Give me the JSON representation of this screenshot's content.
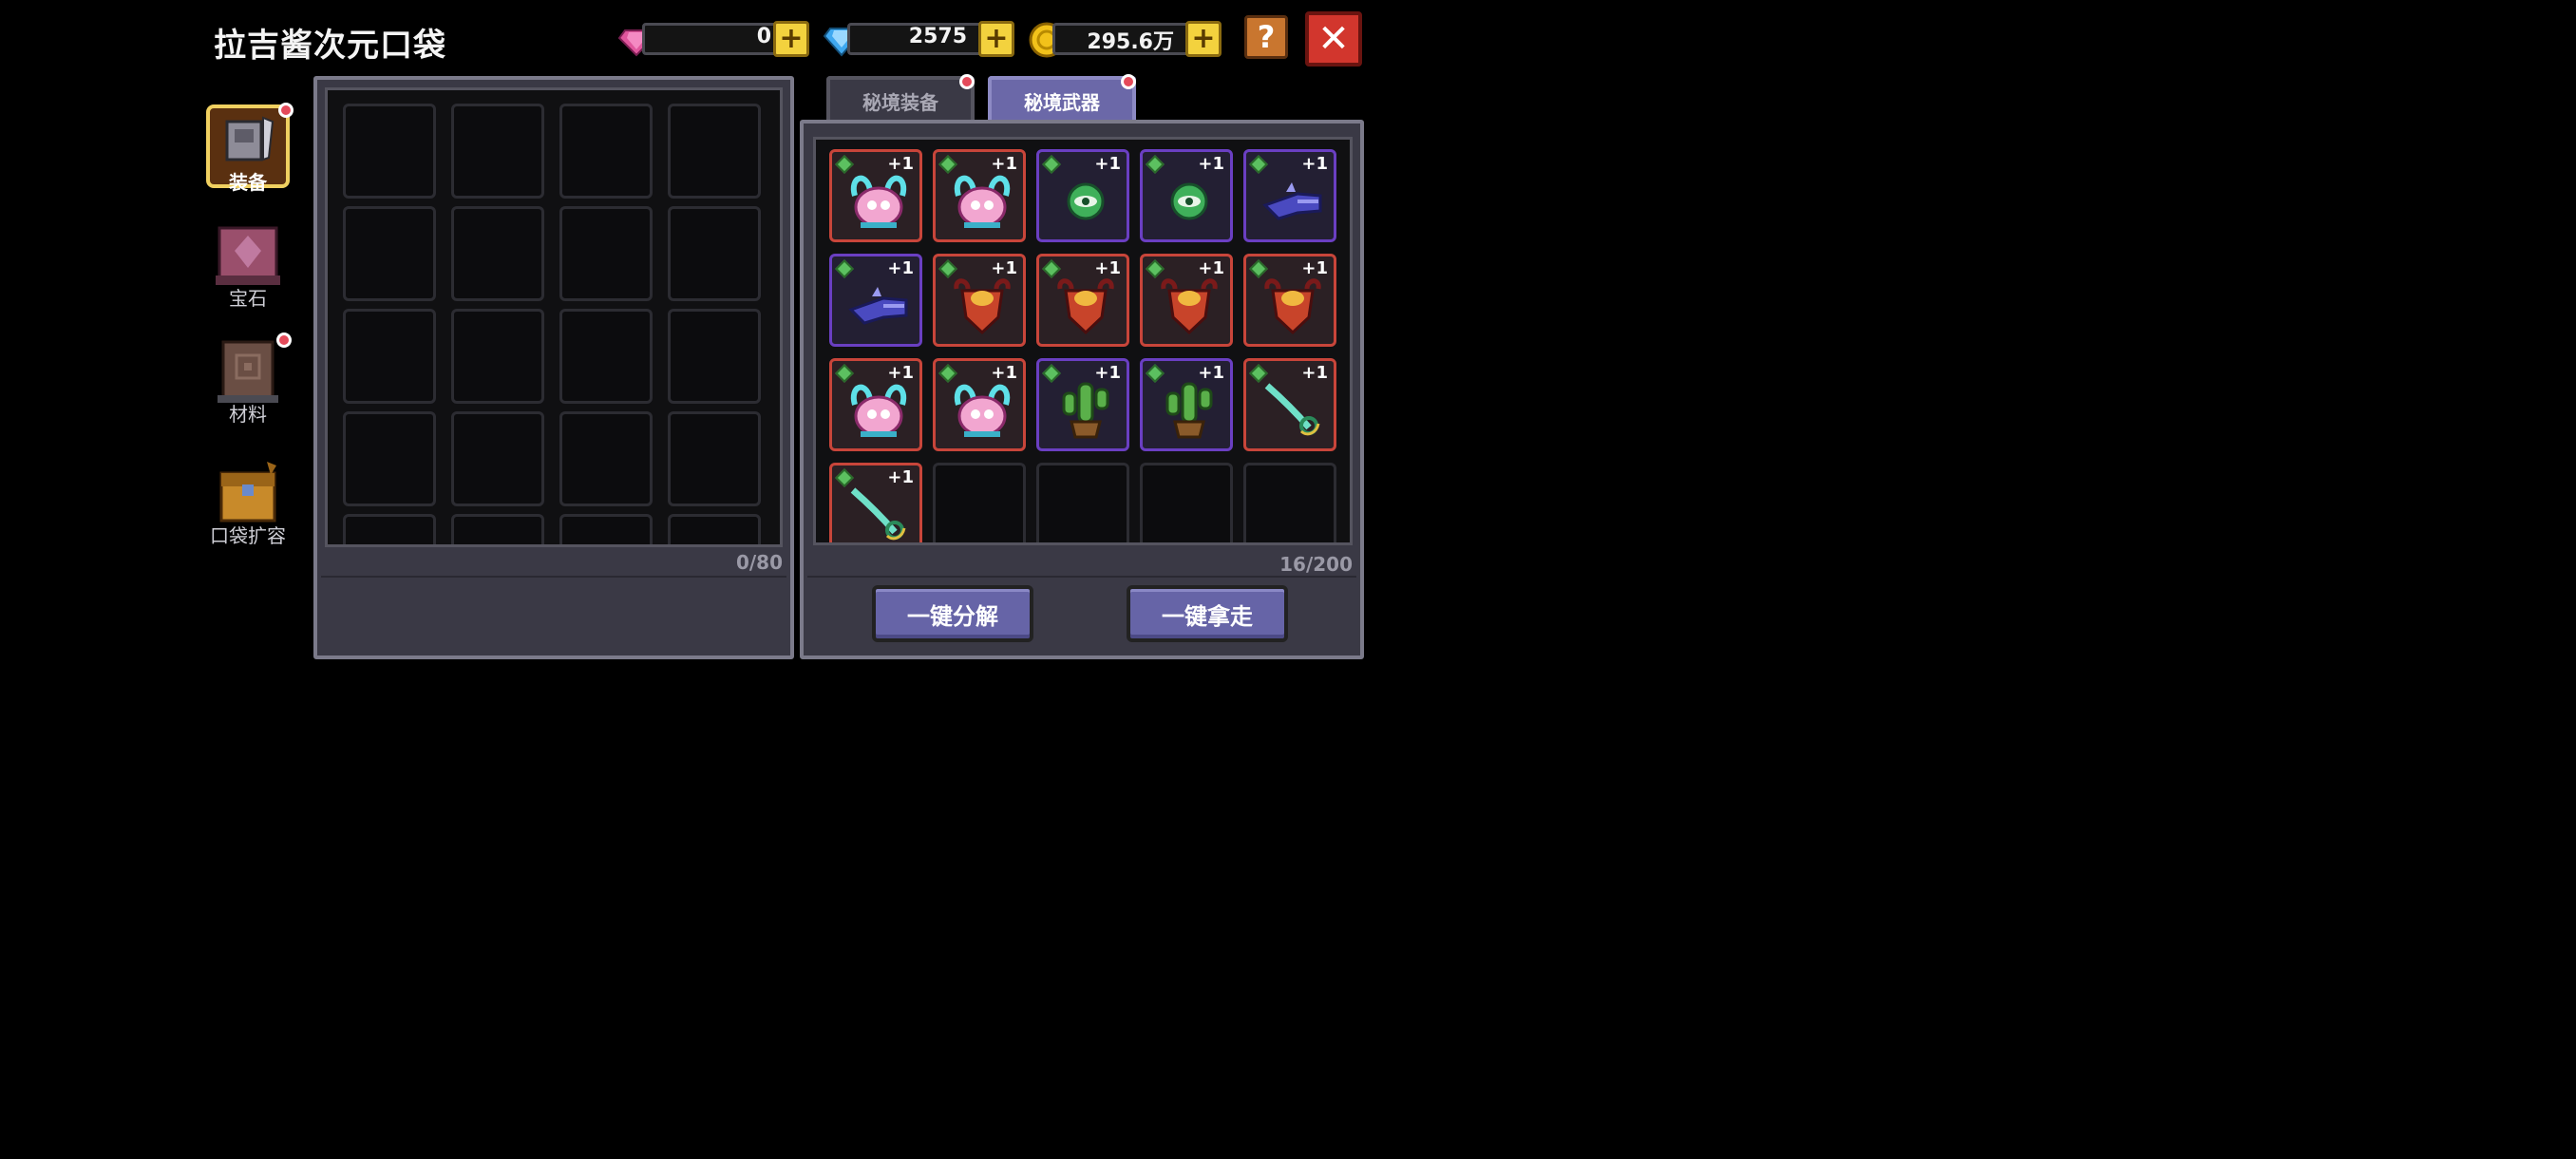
{
  "header": {
    "title": "拉吉酱次元口袋"
  },
  "currency": {
    "pink_gem": "0",
    "diamond": "2575",
    "gold": "295.6万",
    "plus_label": "+"
  },
  "help_label": "?",
  "close_label": "✕",
  "nav": [
    {
      "label": "装备",
      "icon": "armor-icon",
      "active": true,
      "badge": true
    },
    {
      "label": "宝石",
      "icon": "gem-throne-icon",
      "active": false,
      "badge": false
    },
    {
      "label": "材料",
      "icon": "material-box-icon",
      "active": false,
      "badge": true
    },
    {
      "label": "口袋扩容",
      "icon": "treasure-chest-icon",
      "active": false,
      "badge": false
    }
  ],
  "left_panel": {
    "counter": "0/80"
  },
  "tabs": [
    {
      "label": "秘境装备",
      "active": false
    },
    {
      "label": "秘境武器",
      "active": true
    }
  ],
  "right_panel": {
    "counter": "16/200",
    "items": [
      {
        "name": "bunny-mask",
        "rarity": "red",
        "level": "+1"
      },
      {
        "name": "bunny-mask",
        "rarity": "red",
        "level": "+1"
      },
      {
        "name": "green-eye-orb",
        "rarity": "purple",
        "level": "+1"
      },
      {
        "name": "green-eye-orb",
        "rarity": "purple",
        "level": "+1"
      },
      {
        "name": "blue-blaster",
        "rarity": "purple",
        "level": "+1"
      },
      {
        "name": "blue-blaster",
        "rarity": "purple",
        "level": "+1"
      },
      {
        "name": "horned-shield",
        "rarity": "red",
        "level": "+1"
      },
      {
        "name": "horned-shield",
        "rarity": "red",
        "level": "+1"
      },
      {
        "name": "horned-shield",
        "rarity": "red",
        "level": "+1"
      },
      {
        "name": "horned-shield",
        "rarity": "red",
        "level": "+1"
      },
      {
        "name": "bunny-mask",
        "rarity": "red",
        "level": "+1"
      },
      {
        "name": "bunny-mask",
        "rarity": "red",
        "level": "+1"
      },
      {
        "name": "potted-cactus",
        "rarity": "purple",
        "level": "+1"
      },
      {
        "name": "potted-cactus",
        "rarity": "purple",
        "level": "+1"
      },
      {
        "name": "jade-dagger",
        "rarity": "red",
        "level": "+1"
      },
      {
        "name": "jade-dagger",
        "rarity": "red",
        "level": "+1"
      }
    ]
  },
  "buttons": {
    "dismantle": "一键分解",
    "take_all": "一键拿走"
  },
  "colors": {
    "red_rarity": "#c8453a",
    "purple_rarity": "#6a3fc2",
    "tab_active": "#6b68a8",
    "plus_button": "#f3d23e",
    "close_button": "#d2362d"
  }
}
